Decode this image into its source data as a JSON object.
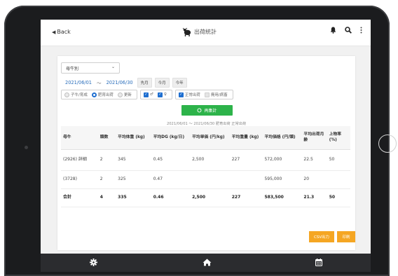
{
  "header": {
    "back_label": "Back",
    "title": "出荷統計",
    "icons": [
      "bell-icon",
      "search-icon",
      "more-vertical-icon"
    ]
  },
  "filter": {
    "category_selected": "母牛別",
    "date_from": "2021/06/01",
    "date_sep": "～",
    "date_to": "2021/06/30",
    "quick_buttons": [
      "先月",
      "今月",
      "今年"
    ]
  },
  "options": {
    "group1": [
      {
        "label": "子牛/育成",
        "checked": false
      },
      {
        "label": "肥育出荷",
        "checked": true
      },
      {
        "label": "更新",
        "checked": false
      }
    ],
    "group2": [
      {
        "label": "♂",
        "checked": true
      },
      {
        "label": "♀",
        "checked": true
      }
    ],
    "group3": [
      {
        "label": "正常出荷",
        "checked": true
      },
      {
        "label": "廃用/病畜",
        "checked": false
      }
    ]
  },
  "recalc_label": "再集計",
  "summary_text": "2021/06/01 ～ 2021/06/30 肥育出荷 正常出荷",
  "table": {
    "headers": [
      "母牛",
      "頭数",
      "平均体重 (kg)",
      "平均DG (kg/日)",
      "平均単価 (円/kg)",
      "平均重量 (kg)",
      "平均価格 (円/頭)",
      "平均出荷月齢",
      "上物率 (%)"
    ],
    "rows": [
      {
        "cow": "(2926) 詳細",
        "count": "2",
        "weight": "345",
        "dg": "0.45",
        "unit_price": "2,500",
        "carcass": "227",
        "price": "572,000",
        "months": "22.5",
        "rate": "50"
      },
      {
        "cow": "(3728)",
        "count": "2",
        "weight": "325",
        "dg": "0.47",
        "unit_price": "",
        "carcass": "",
        "price": "595,000",
        "months": "20",
        "rate": ""
      },
      {
        "cow": "合計",
        "count": "4",
        "weight": "335",
        "dg": "0.46",
        "unit_price": "2,500",
        "carcass": "227",
        "price": "583,500",
        "months": "21.3",
        "rate": "50"
      }
    ]
  },
  "footer_buttons": {
    "csv": "CSV出力",
    "print": "印刷"
  },
  "bottom_nav": [
    "gear-icon",
    "home-icon",
    "calendar-icon"
  ],
  "colors": {
    "accent_blue": "#1f6fd0",
    "green": "#2db34a",
    "orange": "#f5a623",
    "bezel": "#1b1c1e"
  }
}
